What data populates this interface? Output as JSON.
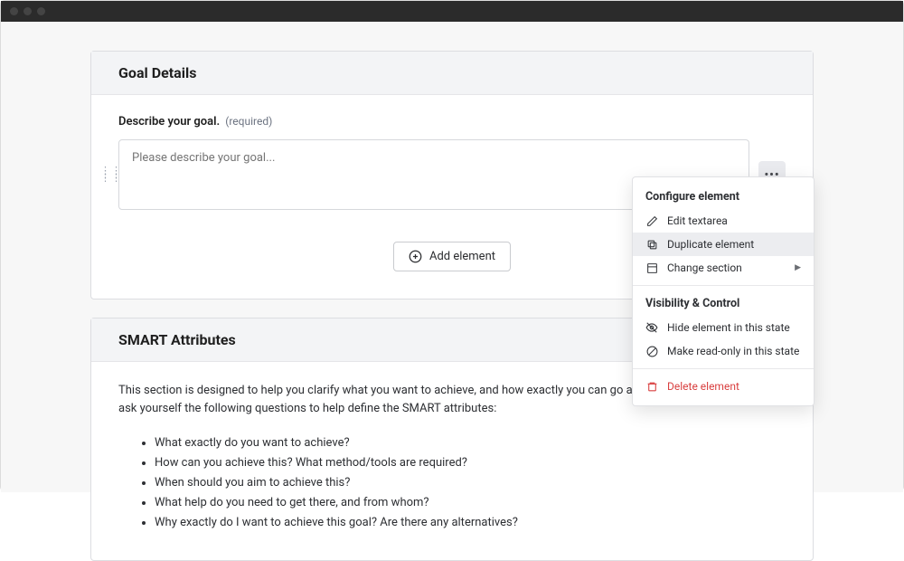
{
  "goal_card": {
    "title": "Goal Details",
    "field_label": "Describe your goal.",
    "required_label": "(required)",
    "textarea_placeholder": "Please describe your goal...",
    "add_button_label": "Add element"
  },
  "smart_card": {
    "title": "SMART Attributes",
    "description": "This section is designed to help you clarify what you want to achieve, and how exactly you can go about achieving it. You can ask yourself the following questions to help define the SMART attributes:",
    "bullets": [
      "What exactly do you want to achieve?",
      "How can you achieve this? What method/tools are required?",
      "When should you aim to achieve this?",
      "What help do you need to get there, and from whom?",
      "Why exactly do I want to achieve this goal? Are there any alternatives?"
    ]
  },
  "dropdown": {
    "group1_title": "Configure element",
    "item_edit": "Edit textarea",
    "item_duplicate": "Duplicate element",
    "item_change_section": "Change section",
    "group2_title": "Visibility & Control",
    "item_hide": "Hide element in this state",
    "item_readonly": "Make read-only in this state",
    "item_delete": "Delete element"
  }
}
